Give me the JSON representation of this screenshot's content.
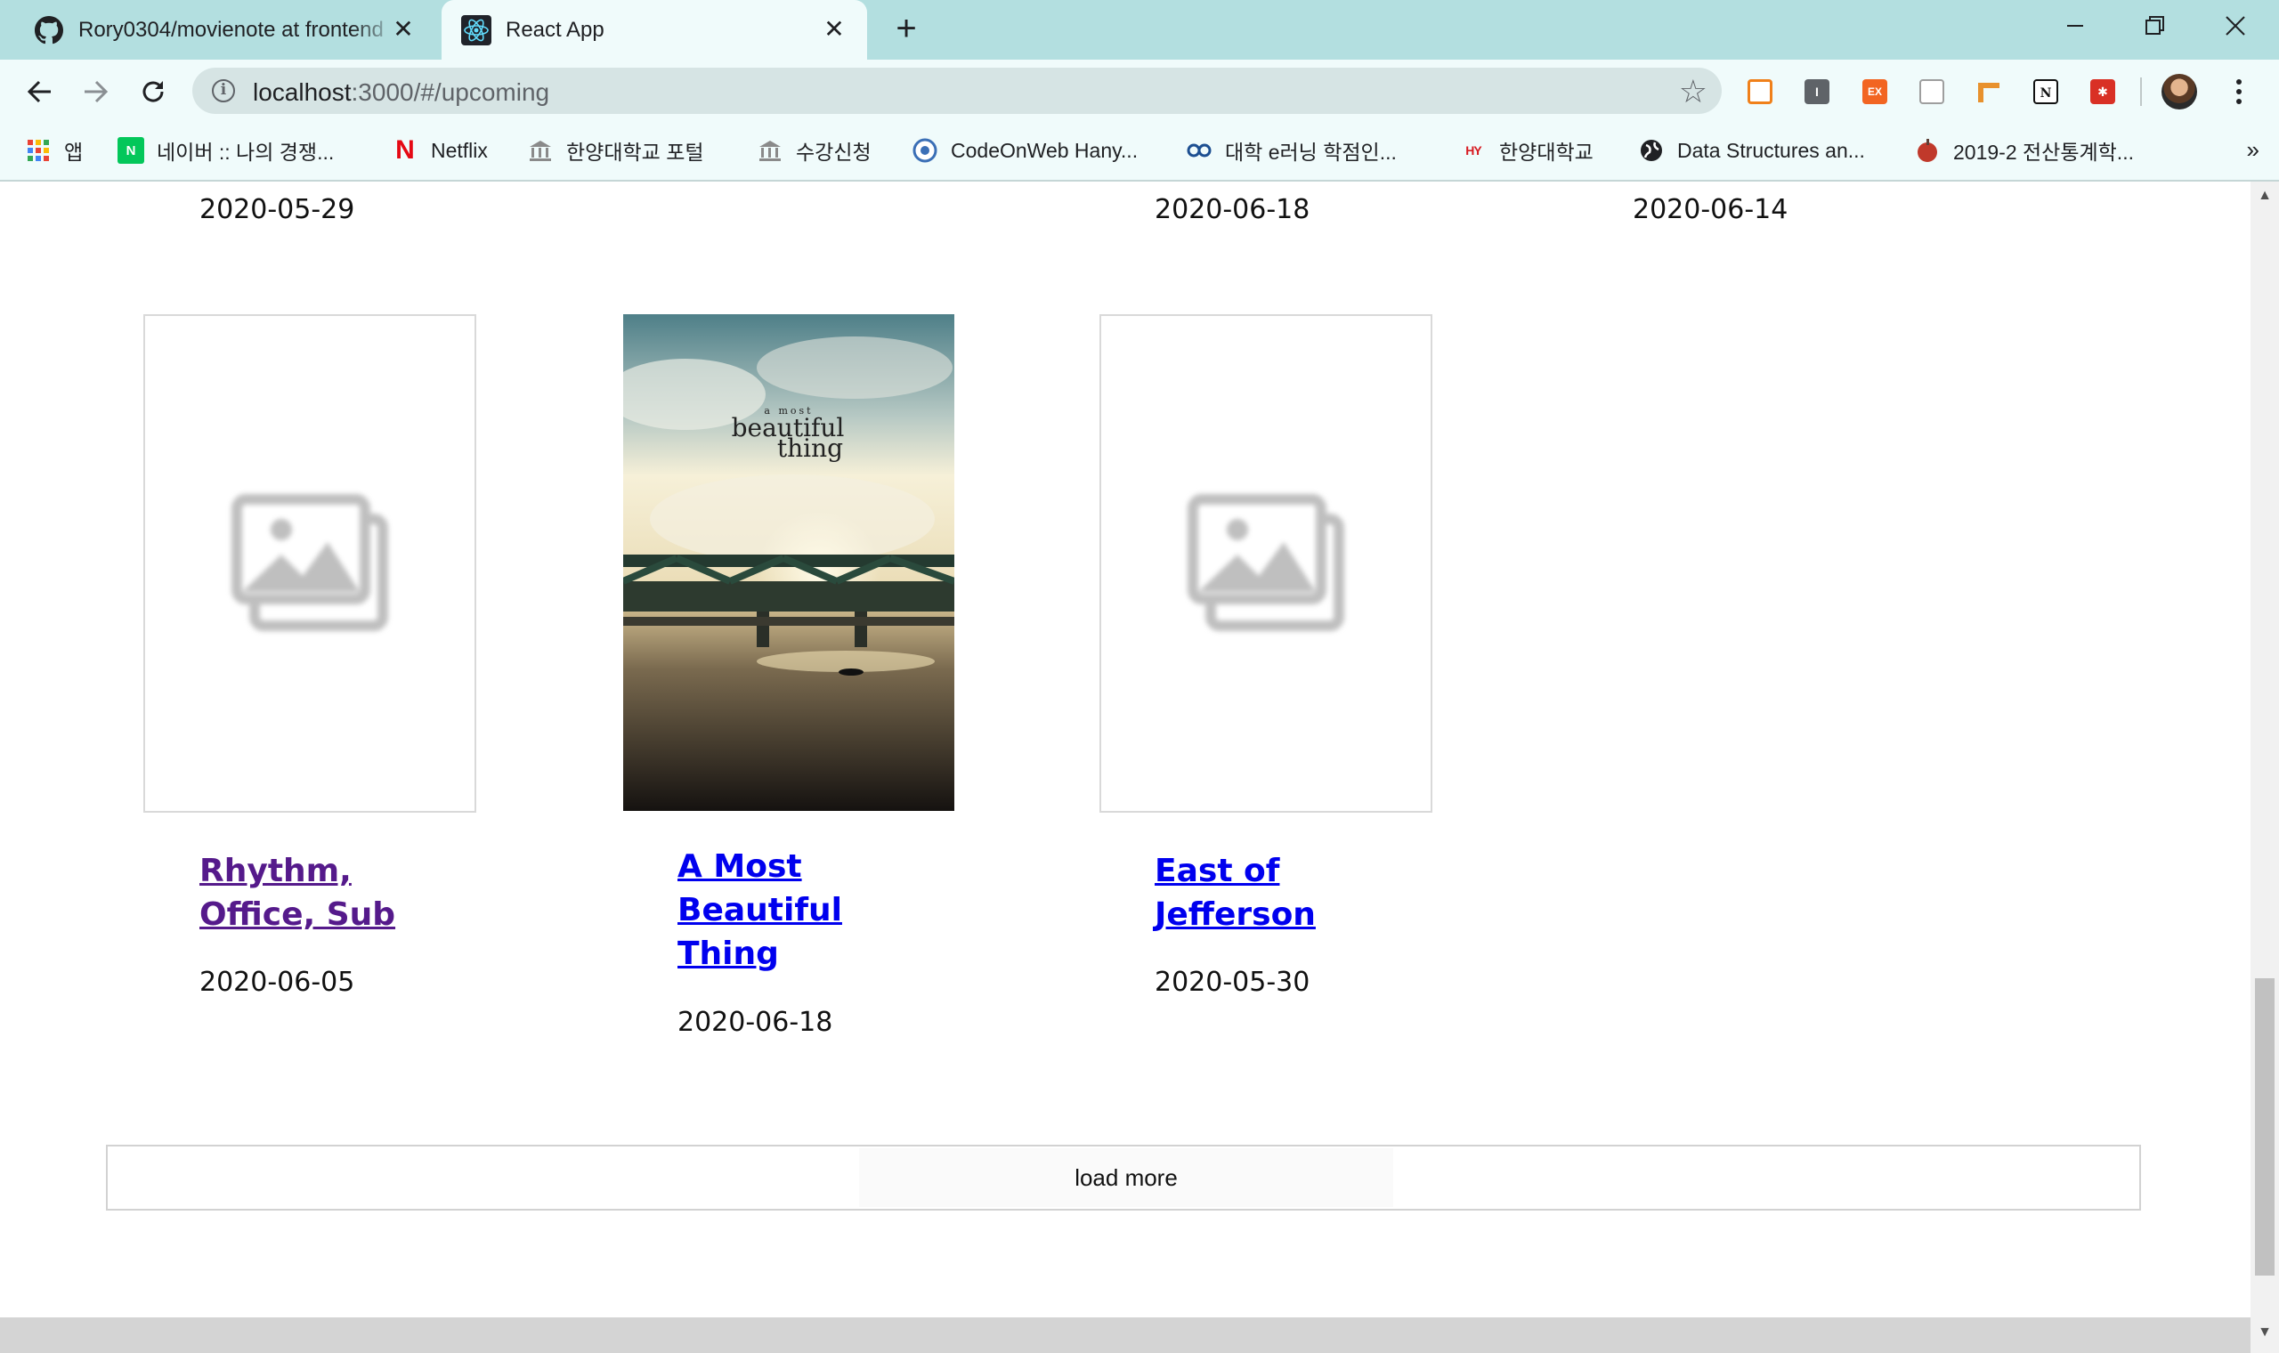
{
  "browser": {
    "tabs": [
      {
        "title": "Rory0304/movienote at frontend",
        "favicon": "github-icon",
        "active": false
      },
      {
        "title": "React App",
        "favicon": "react-icon",
        "active": true
      }
    ],
    "close_glyph": "✕",
    "new_tab_glyph": "+",
    "url": {
      "host": "localhost",
      "rest": ":3000/#/upcoming"
    },
    "bookmarks": [
      {
        "label": "앱",
        "icon": "apps-grid-icon"
      },
      {
        "label": "네이버 :: 나의 경쟁...",
        "icon": "naver-icon"
      },
      {
        "label": "Netflix",
        "icon": "netflix-icon"
      },
      {
        "label": "한양대학교 포털",
        "icon": "building-icon"
      },
      {
        "label": "수강신청",
        "icon": "building-icon"
      },
      {
        "label": "CodeOnWeb Hany...",
        "icon": "codeonweb-icon"
      },
      {
        "label": "대학 e러닝 학점인...",
        "icon": "elearning-icon"
      },
      {
        "label": "한양대학교",
        "icon": "hyu-icon"
      },
      {
        "label": "Data Structures an...",
        "icon": "globe-icon"
      },
      {
        "label": "2019-2 전산통계학...",
        "icon": "apple-icon"
      }
    ],
    "bookmarks_overflow": "»",
    "extensions": [
      {
        "name": "layout-extension-icon",
        "color": "#f0801a",
        "text": ""
      },
      {
        "name": "i-extension-icon",
        "color": "#5f6368",
        "text": "I"
      },
      {
        "name": "ex-extension-icon",
        "color": "#f26522",
        "text": "EX"
      },
      {
        "name": "window-extension-icon",
        "color": "#9e9e9e",
        "text": ""
      },
      {
        "name": "ruler-extension-icon",
        "color": "#e8912d",
        "text": ""
      },
      {
        "name": "notion-extension-icon",
        "color": "#111111",
        "text": "N"
      },
      {
        "name": "puzzle-extension-icon",
        "color": "#d93025",
        "text": ""
      }
    ]
  },
  "page": {
    "top_row_dates": [
      "2020-05-29",
      "2020-06-18",
      "2020-06-14"
    ],
    "movies": [
      {
        "title_lines": [
          "Rhythm,",
          "Office, Sub"
        ],
        "date": "2020-06-05",
        "poster": "placeholder",
        "visited": true
      },
      {
        "title_lines": [
          "A Most",
          "Beautiful",
          "Thing"
        ],
        "date": "2020-06-18",
        "poster": "photo",
        "poster_text": [
          "a most",
          "beautiful",
          "thing"
        ],
        "visited": false
      },
      {
        "title_lines": [
          "East of",
          "Jefferson"
        ],
        "date": "2020-05-30",
        "poster": "placeholder",
        "visited": false
      }
    ],
    "load_more_label": "load more"
  },
  "colors": {
    "tabstrip": "#b3dfe0",
    "toolbar": "#f0fbfb",
    "visited_link": "#551a8b",
    "link": "#0000ee"
  }
}
